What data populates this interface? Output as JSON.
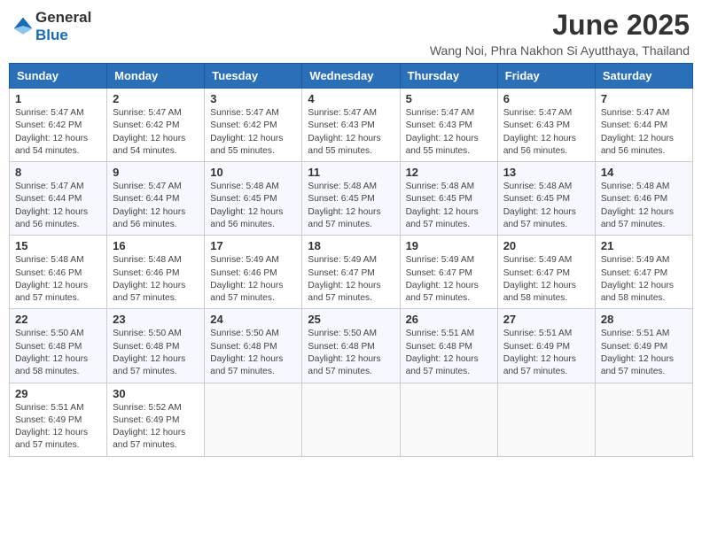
{
  "logo": {
    "general": "General",
    "blue": "Blue"
  },
  "title": "June 2025",
  "subtitle": "Wang Noi, Phra Nakhon Si Ayutthaya, Thailand",
  "headers": [
    "Sunday",
    "Monday",
    "Tuesday",
    "Wednesday",
    "Thursday",
    "Friday",
    "Saturday"
  ],
  "weeks": [
    [
      {
        "day": "1",
        "sunrise": "5:47 AM",
        "sunset": "6:42 PM",
        "daylight": "12 hours and 54 minutes."
      },
      {
        "day": "2",
        "sunrise": "5:47 AM",
        "sunset": "6:42 PM",
        "daylight": "12 hours and 54 minutes."
      },
      {
        "day": "3",
        "sunrise": "5:47 AM",
        "sunset": "6:42 PM",
        "daylight": "12 hours and 55 minutes."
      },
      {
        "day": "4",
        "sunrise": "5:47 AM",
        "sunset": "6:43 PM",
        "daylight": "12 hours and 55 minutes."
      },
      {
        "day": "5",
        "sunrise": "5:47 AM",
        "sunset": "6:43 PM",
        "daylight": "12 hours and 55 minutes."
      },
      {
        "day": "6",
        "sunrise": "5:47 AM",
        "sunset": "6:43 PM",
        "daylight": "12 hours and 56 minutes."
      },
      {
        "day": "7",
        "sunrise": "5:47 AM",
        "sunset": "6:44 PM",
        "daylight": "12 hours and 56 minutes."
      }
    ],
    [
      {
        "day": "8",
        "sunrise": "5:47 AM",
        "sunset": "6:44 PM",
        "daylight": "12 hours and 56 minutes."
      },
      {
        "day": "9",
        "sunrise": "5:47 AM",
        "sunset": "6:44 PM",
        "daylight": "12 hours and 56 minutes."
      },
      {
        "day": "10",
        "sunrise": "5:48 AM",
        "sunset": "6:45 PM",
        "daylight": "12 hours and 56 minutes."
      },
      {
        "day": "11",
        "sunrise": "5:48 AM",
        "sunset": "6:45 PM",
        "daylight": "12 hours and 57 minutes."
      },
      {
        "day": "12",
        "sunrise": "5:48 AM",
        "sunset": "6:45 PM",
        "daylight": "12 hours and 57 minutes."
      },
      {
        "day": "13",
        "sunrise": "5:48 AM",
        "sunset": "6:45 PM",
        "daylight": "12 hours and 57 minutes."
      },
      {
        "day": "14",
        "sunrise": "5:48 AM",
        "sunset": "6:46 PM",
        "daylight": "12 hours and 57 minutes."
      }
    ],
    [
      {
        "day": "15",
        "sunrise": "5:48 AM",
        "sunset": "6:46 PM",
        "daylight": "12 hours and 57 minutes."
      },
      {
        "day": "16",
        "sunrise": "5:48 AM",
        "sunset": "6:46 PM",
        "daylight": "12 hours and 57 minutes."
      },
      {
        "day": "17",
        "sunrise": "5:49 AM",
        "sunset": "6:46 PM",
        "daylight": "12 hours and 57 minutes."
      },
      {
        "day": "18",
        "sunrise": "5:49 AM",
        "sunset": "6:47 PM",
        "daylight": "12 hours and 57 minutes."
      },
      {
        "day": "19",
        "sunrise": "5:49 AM",
        "sunset": "6:47 PM",
        "daylight": "12 hours and 57 minutes."
      },
      {
        "day": "20",
        "sunrise": "5:49 AM",
        "sunset": "6:47 PM",
        "daylight": "12 hours and 58 minutes."
      },
      {
        "day": "21",
        "sunrise": "5:49 AM",
        "sunset": "6:47 PM",
        "daylight": "12 hours and 58 minutes."
      }
    ],
    [
      {
        "day": "22",
        "sunrise": "5:50 AM",
        "sunset": "6:48 PM",
        "daylight": "12 hours and 58 minutes."
      },
      {
        "day": "23",
        "sunrise": "5:50 AM",
        "sunset": "6:48 PM",
        "daylight": "12 hours and 57 minutes."
      },
      {
        "day": "24",
        "sunrise": "5:50 AM",
        "sunset": "6:48 PM",
        "daylight": "12 hours and 57 minutes."
      },
      {
        "day": "25",
        "sunrise": "5:50 AM",
        "sunset": "6:48 PM",
        "daylight": "12 hours and 57 minutes."
      },
      {
        "day": "26",
        "sunrise": "5:51 AM",
        "sunset": "6:48 PM",
        "daylight": "12 hours and 57 minutes."
      },
      {
        "day": "27",
        "sunrise": "5:51 AM",
        "sunset": "6:49 PM",
        "daylight": "12 hours and 57 minutes."
      },
      {
        "day": "28",
        "sunrise": "5:51 AM",
        "sunset": "6:49 PM",
        "daylight": "12 hours and 57 minutes."
      }
    ],
    [
      {
        "day": "29",
        "sunrise": "5:51 AM",
        "sunset": "6:49 PM",
        "daylight": "12 hours and 57 minutes."
      },
      {
        "day": "30",
        "sunrise": "5:52 AM",
        "sunset": "6:49 PM",
        "daylight": "12 hours and 57 minutes."
      },
      null,
      null,
      null,
      null,
      null
    ]
  ]
}
